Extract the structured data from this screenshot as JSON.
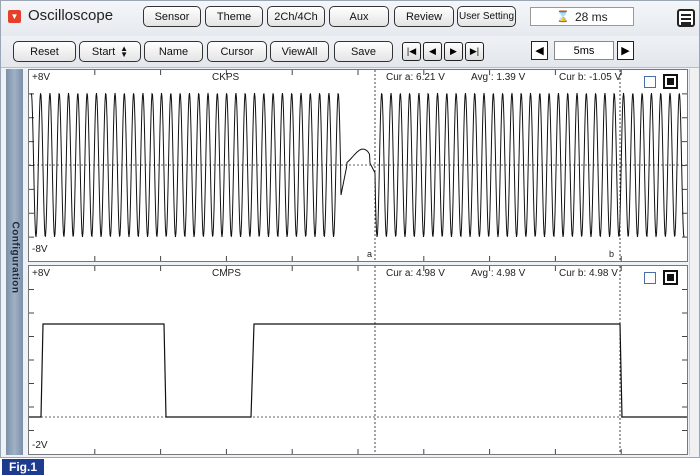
{
  "app": {
    "title": "Oscilloscope",
    "time_display": "28 ms"
  },
  "toolbar_top": [
    "Sensor",
    "Theme",
    "2Ch/4Ch",
    "Aux",
    "Review",
    "User Setting"
  ],
  "toolbar_bottom": {
    "reset": "Reset",
    "start": "Start",
    "name": "Name",
    "cursor": "Cursor",
    "viewall": "ViewAll",
    "save": "Save",
    "time_div": "5ms"
  },
  "side_tab": "Configuration",
  "channels": [
    {
      "name": "CKPS",
      "max_label": "+8V",
      "min_label": "-8V",
      "cur_a": "Cur a: 6.21 V",
      "avg": "Avg  : 1.39 V",
      "cur_b": "Cur b: -1.05 V",
      "cursor_a": "a",
      "cursor_b": "b"
    },
    {
      "name": "CMPS",
      "max_label": "+8V",
      "min_label": "-2V",
      "cur_a": "Cur a: 4.98 V",
      "avg": "Avg  : 4.98 V",
      "cur_b": "Cur b: 4.98 V"
    }
  ],
  "figure_label": "Fig.1",
  "colors": {
    "trace": "#111111",
    "side_tab": "#8a9db3",
    "figure_tag": "#1d3b8f",
    "record_icon": "#e6402b"
  }
}
